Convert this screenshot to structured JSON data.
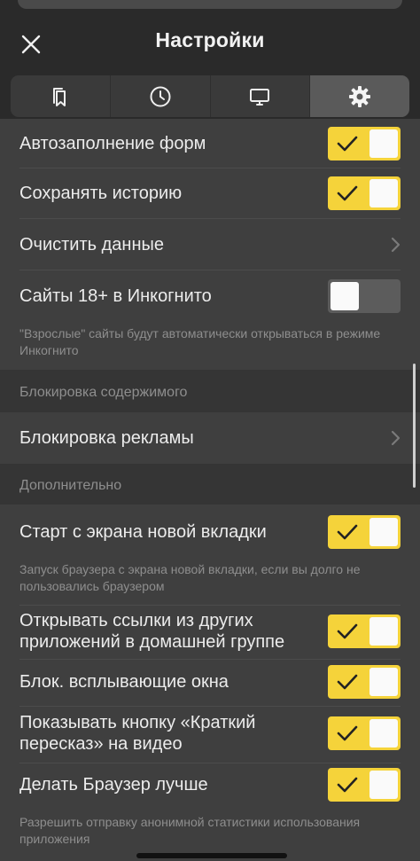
{
  "header": {
    "title": "Настройки"
  },
  "tabs": [
    {
      "icon": "bookmarks-icon",
      "active": false
    },
    {
      "icon": "history-clock-icon",
      "active": false
    },
    {
      "icon": "desktop-icon",
      "active": false
    },
    {
      "icon": "gear-icon",
      "active": true
    }
  ],
  "settings": {
    "autofill": {
      "label": "Автозаполнение форм",
      "enabled": true
    },
    "save_history": {
      "label": "Сохранять историю",
      "enabled": true
    },
    "clear_data": {
      "label": "Очистить данные"
    },
    "adult_incognito": {
      "label": "Сайты 18+ в Инкогнито",
      "enabled": false,
      "note": "\"Взрослые\" сайты будут автоматически открываться в режиме Инкогнито"
    }
  },
  "content_blocking": {
    "title": "Блокировка содержимого",
    "ad_block": {
      "label": "Блокировка рекламы"
    }
  },
  "additional": {
    "title": "Дополнительно",
    "new_tab_start": {
      "label": "Старт с экрана новой вкладки",
      "enabled": true,
      "note": "Запуск браузера с экрана новой вкладки, если вы долго не пользовались браузером"
    },
    "open_links": {
      "label_line1": "Открывать ссылки из других",
      "label_line2": "приложений в домашней группе",
      "enabled": true
    },
    "block_popups": {
      "label": "Блок. всплывающие окна",
      "enabled": true
    },
    "summary_button": {
      "label_line1": "Показывать кнопку «Краткий",
      "label_line2": "пересказ» на видео",
      "enabled": true
    },
    "improve_browser": {
      "label": "Делать Браузер лучше",
      "enabled": true,
      "note": "Разрешить отправку анонимной статистики использования приложения"
    }
  },
  "colors": {
    "accent": "#f5d33a",
    "background": "#3f3f3f",
    "header": "#2a2a2a"
  }
}
